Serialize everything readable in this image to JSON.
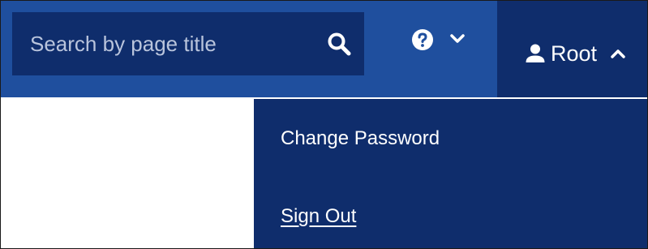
{
  "header": {
    "search": {
      "placeholder": "Search by page title",
      "value": "",
      "icon": "search-icon"
    },
    "help_menu": {
      "icon": "help-icon",
      "chevron": "chevron-down-icon"
    },
    "user_menu": {
      "icon": "user-icon",
      "label": "Root",
      "chevron": "chevron-up-icon",
      "expanded": true
    }
  },
  "user_dropdown": {
    "items": [
      {
        "label": "Change Password"
      },
      {
        "label": "Sign Out"
      }
    ]
  },
  "colors": {
    "header_bg": "#1f4f9e",
    "menu_bg": "#0f2d6c",
    "text": "#ffffff",
    "placeholder": "#b9c4dc"
  }
}
